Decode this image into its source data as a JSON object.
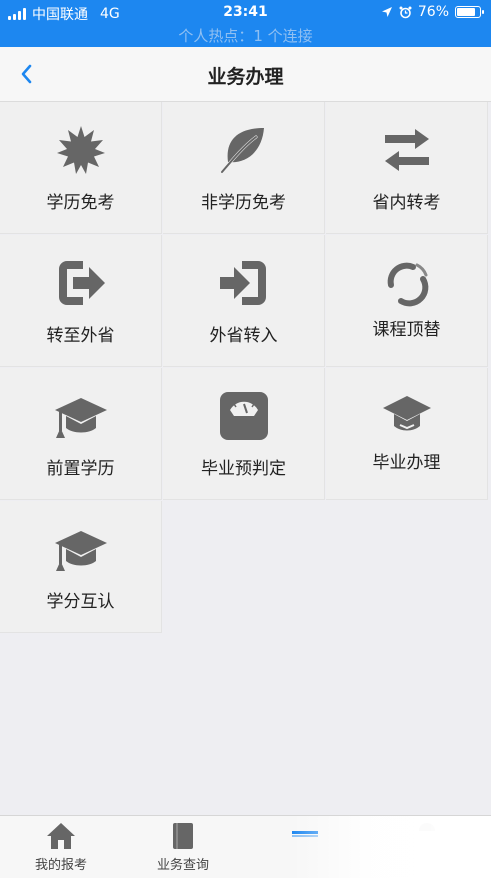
{
  "status": {
    "carrier": "中国联通",
    "network": "4G",
    "time": "23:41",
    "battery": "76%",
    "hotspot": "个人热点：1 个连接"
  },
  "nav": {
    "title": "业务办理"
  },
  "services": [
    {
      "label": "学历免考",
      "icon": "starburst-icon"
    },
    {
      "label": "非学历免考",
      "icon": "leaf-icon"
    },
    {
      "label": "省内转考",
      "icon": "swap-arrows-icon"
    },
    {
      "label": "转至外省",
      "icon": "exit-icon"
    },
    {
      "label": "外省转入",
      "icon": "enter-icon"
    },
    {
      "label": "课程顶替",
      "icon": "refresh-circle-icon"
    },
    {
      "label": "前置学历",
      "icon": "graduation-cap-icon"
    },
    {
      "label": "毕业预判定",
      "icon": "scale-icon"
    },
    {
      "label": "毕业办理",
      "icon": "graduation-cap-icon"
    },
    {
      "label": "学分互认",
      "icon": "graduation-cap-icon"
    }
  ],
  "tabs": [
    {
      "label": "我的报考",
      "icon": "home-icon"
    },
    {
      "label": "业务查询",
      "icon": "book-icon"
    },
    {
      "label": "",
      "icon": "business-icon"
    },
    {
      "label": "",
      "icon": "profile-icon"
    }
  ],
  "colors": {
    "status_bar": "#1d87f0",
    "accent": "#1d87f0",
    "icon_gray": "#666666"
  }
}
